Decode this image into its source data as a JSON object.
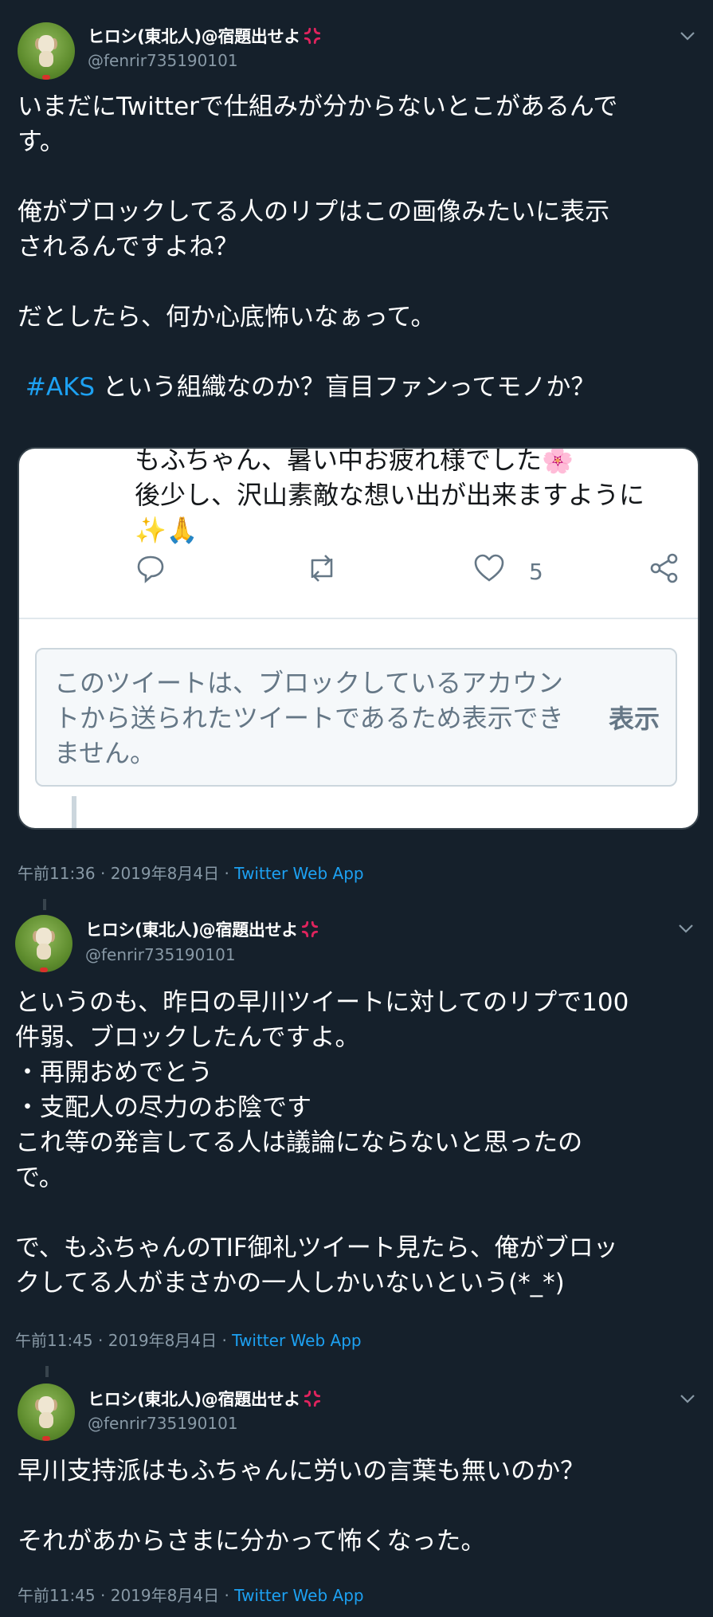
{
  "colors": {
    "background": "#15202b",
    "text_primary": "#ffffff",
    "text_secondary": "#8899a6",
    "accent": "#1da1f2"
  },
  "tweets": [
    {
      "display_name": "ヒロシ(東北人)@宿題出せよ",
      "handle": "@fenrir735190101",
      "text_lines": [
        "いまだにTwitterで仕組みが分からないとこがあるんで\nす。\n\n俺がブロックしてる人のリプはこの画像みたいに表示\nされるんですよね？\n\nだとしたら、何か心底怖いなぁって。\n\n"
      ],
      "hashtag": "#AKS",
      "text_after_hashtag": " という組織なのか？盲目ファンってモノか？",
      "time": "午前11:36",
      "date": "2019年8月4日",
      "separator": "·",
      "source": "Twitter Web App",
      "embedded_screenshot": {
        "tweet_text": "もふちゃん、暑い中お疲れ様でした🌸\n後少し、沢山素敵な想い出が出来ますように\n✨🙏",
        "like_count": "5",
        "blocked_notice": "このツイートは、ブロックしているアカウントから送られたツイートであるため表示できません。",
        "show_label": "表示"
      }
    },
    {
      "display_name": "ヒロシ(東北人)@宿題出せよ",
      "handle": "@fenrir735190101",
      "text": "というのも、昨日の早川ツイートに対してのリプで100\n件弱、ブロックしたんですよ。\n・再開おめでとう\n・支配人の尽力のお陰です\nこれ等の発言してる人は議論にならないと思ったの\nで。\n\nで、もふちゃんのTIF御礼ツイート見たら、俺がブロッ\nクしてる人がまさかの一人しかいないという(*_*)",
      "time": "午前11:45",
      "date": "2019年8月4日",
      "separator": "·",
      "source": "Twitter Web App"
    },
    {
      "display_name": "ヒロシ(東北人)@宿題出せよ",
      "handle": "@fenrir735190101",
      "text": "早川支持派はもふちゃんに労いの言葉も無いのか？\n\nそれがあからさまに分かって怖くなった。",
      "time": "午前11:45",
      "date": "2019年8月4日",
      "separator": "·",
      "source": "Twitter Web App"
    }
  ],
  "icons": [
    "avatar",
    "anger-symbol-icon",
    "chevron-down-icon",
    "reply-icon",
    "retweet-icon",
    "like-icon",
    "share-icon"
  ]
}
